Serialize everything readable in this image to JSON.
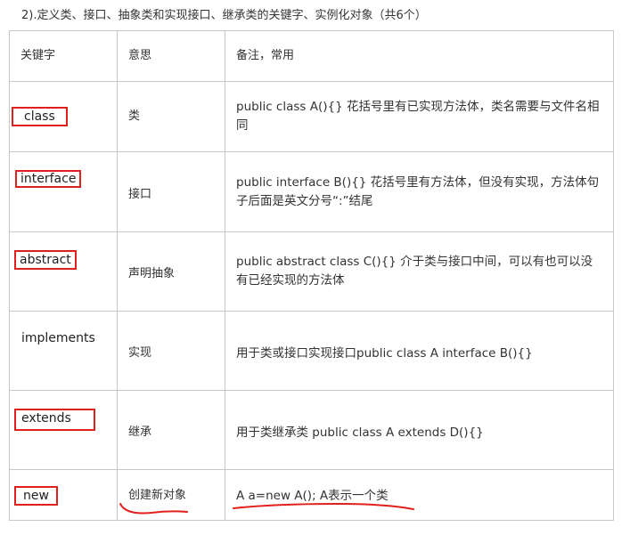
{
  "heading": "2).定义类、接口、抽象类和实现接口、继承类的关键字、实例化对象（共6个）",
  "table": {
    "headers": [
      "关键字",
      "意思",
      "备注，常用"
    ],
    "rows": [
      {
        "keyword": "class",
        "meaning": "类",
        "note": "public class A(){}  花括号里有已实现方法体，类名需要与文件名相同"
      },
      {
        "keyword": "interface",
        "meaning": "接口",
        "note": "public interface B(){}  花括号里有方法体，但没有实现，方法体句子后面是英文分号“:”结尾"
      },
      {
        "keyword": "abstract",
        "meaning": "声明抽象",
        "note": "public abstract class C(){} 介于类与接口中间，可以有也可以没有已经实现的方法体"
      },
      {
        "keyword": "implements",
        "meaning": "实现",
        "note": "用于类或接口实现接口public class A  interface B(){}"
      },
      {
        "keyword": "extends",
        "meaning": "继承",
        "note": "用于类继承类 public class A extends D(){}"
      },
      {
        "keyword": "new",
        "meaning": "创建新对象",
        "note": "A a=new A();  A表示一个类"
      }
    ]
  },
  "annotations": {
    "box_color": "#e0201c",
    "underline_color": "#e0201c"
  }
}
